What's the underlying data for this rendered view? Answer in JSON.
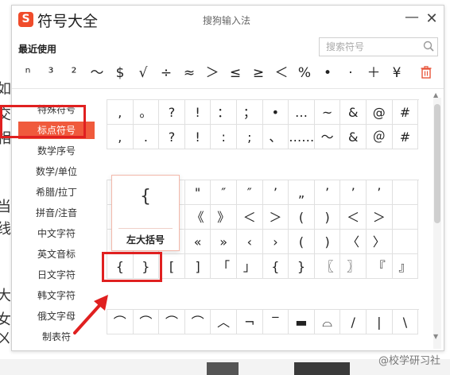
{
  "app": {
    "title": "符号大全",
    "subtitle": "搜狗输入法",
    "logo": "S",
    "minimize_icon": "—",
    "close_icon": "✕"
  },
  "recent": {
    "label": "最近使用",
    "symbols": [
      "ⁿ",
      "³",
      "²",
      "～",
      "$",
      "√",
      "÷",
      "≈",
      "＞",
      "≤",
      "≥",
      "＜",
      "%",
      "•",
      "·",
      "＋",
      "¥"
    ]
  },
  "search": {
    "placeholder": "搜索符号"
  },
  "sidebar": {
    "items": [
      {
        "label": "特殊符号"
      },
      {
        "label": "标点符号"
      },
      {
        "label": "数学序号"
      },
      {
        "label": "数学/单位"
      },
      {
        "label": "希腊/拉丁"
      },
      {
        "label": "拼音/注音"
      },
      {
        "label": "中文字符"
      },
      {
        "label": "英文音标"
      },
      {
        "label": "日文字符"
      },
      {
        "label": "韩文字符"
      },
      {
        "label": "俄文字母"
      },
      {
        "label": "制表符"
      }
    ],
    "active_index": 1
  },
  "grid": {
    "section1": [
      [
        ",",
        "。",
        "?",
        "!",
        "：",
        "；",
        "•",
        "…",
        "~",
        "&",
        "@",
        "#"
      ],
      [
        ",",
        ".",
        "?",
        "!",
        ":",
        ";",
        "、",
        "……",
        "～",
        "&",
        "＠",
        "#"
      ]
    ],
    "section2": [
      [
        "",
        "",
        "’",
        "\"",
        "″",
        "″",
        "’",
        "„",
        "’",
        "’",
        "’",
        ""
      ],
      [
        "",
        "",
        "】",
        "《",
        "》",
        "＜",
        "＞",
        "(",
        ")",
        "＜",
        "＞",
        ""
      ],
      [
        "",
        "",
        "]",
        "«",
        "»",
        "‹",
        "›",
        "(",
        ")",
        "〈",
        "〉",
        ""
      ],
      [
        "{",
        "}",
        "[",
        "]",
        "「",
        "」",
        "{",
        "}",
        "〖",
        "〗",
        "『",
        "』"
      ]
    ],
    "section3": [
      [
        "⌒",
        "⌒",
        "⌒",
        "⌒",
        "︿",
        "¬",
        "‾",
        "▬",
        "⌓",
        "/",
        "|",
        "\\"
      ]
    ]
  },
  "tooltip": {
    "char": "{",
    "label": "左大括号"
  },
  "background": {
    "left_chars": [
      "如",
      "交",
      "相",
      "当",
      "线",
      "大",
      "女",
      "ㄨ"
    ],
    "watermark": "@校学研习社"
  },
  "colors": {
    "accent": "#f05a3c",
    "highlight": "#e02020",
    "logo": "#f04c2b"
  }
}
